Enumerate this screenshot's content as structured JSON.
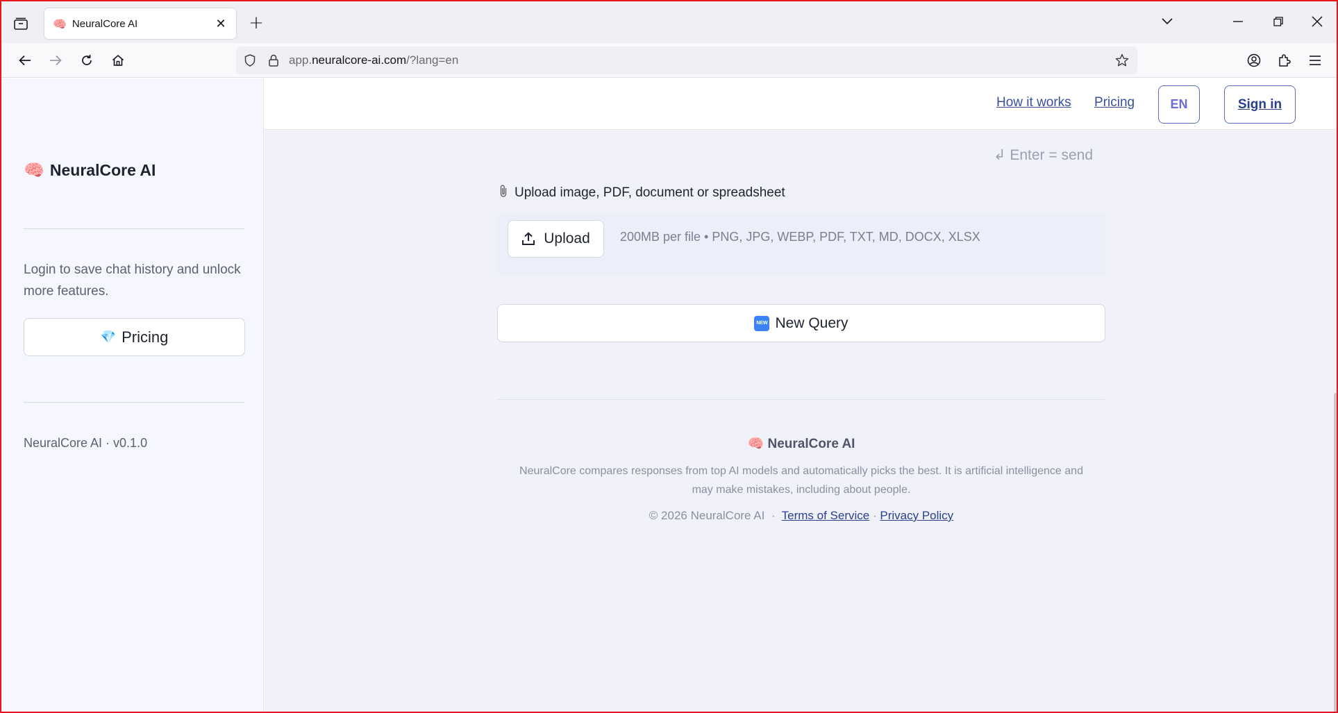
{
  "browser": {
    "tab_title": "NeuralCore AI",
    "tab_favicon": "🧠",
    "url_domain_prefix": "app.",
    "url_domain": "neuralcore-ai.com",
    "url_path": "/?lang=en"
  },
  "sidebar": {
    "brand_emoji": "🧠",
    "brand_name": "NeuralCore AI",
    "login_note": "Login to save chat history and unlock more features.",
    "pricing_emoji": "💎",
    "pricing_label": "Pricing",
    "version": "NeuralCore AI · v0.1.0"
  },
  "topbar": {
    "how_it_works": "How it works",
    "pricing": "Pricing",
    "language": "EN",
    "sign_in": "Sign in"
  },
  "composer": {
    "enter_hint": "↲ Enter = send",
    "upload_label": "Upload image, PDF, document or spreadsheet",
    "upload_button": "Upload",
    "upload_limits": "200MB per file • PNG, JPG, WEBP, PDF, TXT, MD, DOCX, XLSX",
    "new_query_badge": "NEW",
    "new_query": "New Query"
  },
  "footer": {
    "brand_emoji": "🧠",
    "brand_name": "NeuralCore AI",
    "description": "NeuralCore compares responses from top AI models and automatically picks the best. It is artificial intelligence and may make mistakes, including about people.",
    "copyright": "© 2026 NeuralCore AI",
    "sep1": "·",
    "terms": "Terms of Service",
    "sep2": "·",
    "privacy": "Privacy Policy"
  }
}
